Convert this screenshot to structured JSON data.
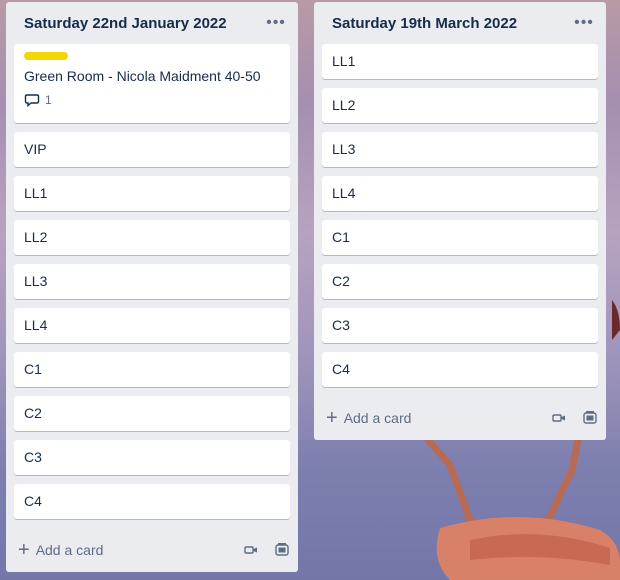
{
  "lists": [
    {
      "title": "Saturday 22nd January 2022",
      "menu_icon": "more-horizontal-icon",
      "cards": [
        {
          "title": "Green Room - Nicola Maidment 40-50",
          "label_color": "#f2d600",
          "comment_count": "1"
        },
        {
          "title": "VIP"
        },
        {
          "title": "LL1"
        },
        {
          "title": "LL2"
        },
        {
          "title": "LL3"
        },
        {
          "title": "LL4"
        },
        {
          "title": "C1"
        },
        {
          "title": "C2"
        },
        {
          "title": "C3"
        },
        {
          "title": "C4"
        }
      ],
      "add_card_label": "Add a card"
    },
    {
      "title": "Saturday 19th March 2022",
      "menu_icon": "more-horizontal-icon",
      "cards": [
        {
          "title": "LL1"
        },
        {
          "title": "LL2"
        },
        {
          "title": "LL3"
        },
        {
          "title": "LL4"
        },
        {
          "title": "C1"
        },
        {
          "title": "C2"
        },
        {
          "title": "C3"
        },
        {
          "title": "C4"
        }
      ],
      "add_card_label": "Add a card"
    }
  ],
  "colors": {
    "list_bg": "#ebecf0",
    "card_bg": "#ffffff",
    "label_yellow": "#f2d600",
    "text": "#172b4d",
    "muted": "#5e6c84"
  }
}
